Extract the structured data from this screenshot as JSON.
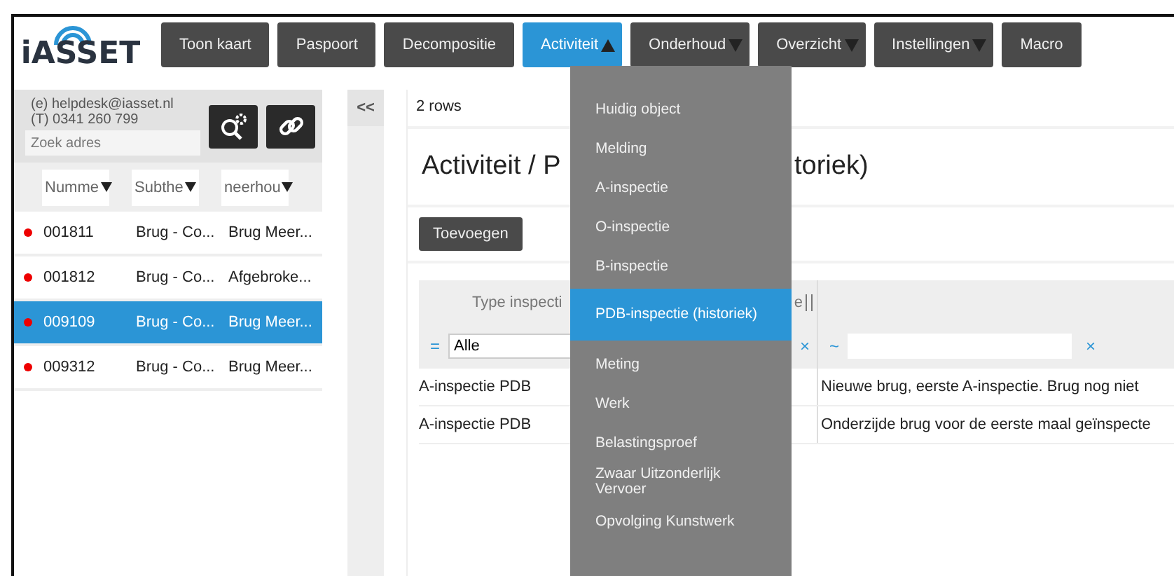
{
  "logo": {
    "text": "iASSET"
  },
  "nav": [
    {
      "label": "Toon kaart",
      "selected": false,
      "dropdown": false
    },
    {
      "label": "Paspoort",
      "selected": false,
      "dropdown": false
    },
    {
      "label": "Decompositie",
      "selected": false,
      "dropdown": false
    },
    {
      "label": "Activiteit",
      "selected": true,
      "dropdown": true,
      "expanded": true
    },
    {
      "label": "Onderhoud",
      "selected": false,
      "dropdown": true,
      "expanded": false
    },
    {
      "label": "Overzicht",
      "selected": false,
      "dropdown": true,
      "expanded": false
    },
    {
      "label": "Instellingen",
      "selected": false,
      "dropdown": true,
      "expanded": false
    },
    {
      "label": "Macro",
      "selected": false,
      "dropdown": false
    }
  ],
  "sidebar": {
    "helpdesk": [
      "(e) helpdesk@iasset.nl",
      "(T) 0341 260 799"
    ],
    "search": {
      "placeholder": "Zoek adres"
    },
    "columns": [
      "Numme",
      "Subthe",
      "neerhou"
    ],
    "rows": [
      {
        "cells": [
          "001811",
          "Brug - Co...",
          "Brug Meer..."
        ],
        "selected": false
      },
      {
        "cells": [
          "001812",
          "Brug - Co...",
          "Afgebroke..."
        ],
        "selected": false
      },
      {
        "cells": [
          "009109",
          "Brug - Co...",
          "Brug Meer..."
        ],
        "selected": true
      },
      {
        "cells": [
          "009312",
          "Brug - Co...",
          "Brug Meer..."
        ],
        "selected": false
      }
    ],
    "collapse": "<<"
  },
  "main": {
    "row_count": "2 rows",
    "title_parts": [
      "Activiteit / P",
      "toriek)"
    ],
    "add_button": "Toevoegen",
    "table": {
      "columns": [
        "Type inspecti",
        "e"
      ],
      "filter": {
        "operator_1": "=",
        "value_1": "Alle",
        "clear_1": "×",
        "operator_2": "~",
        "clear_2": "×"
      },
      "rows": [
        [
          "A-inspectie PDB",
          "Nieuwe brug, eerste A-inspectie. Brug nog niet"
        ],
        [
          "A-inspectie PDB",
          "Onderzijde brug voor de eerste maal geïnspecte"
        ]
      ]
    }
  },
  "menu": {
    "items": [
      {
        "label": "Huidig object",
        "selected": false
      },
      {
        "label": "Melding",
        "selected": false
      },
      {
        "label": "A-inspectie",
        "selected": false
      },
      {
        "label": "O-inspectie",
        "selected": false
      },
      {
        "label": "B-inspectie",
        "selected": false
      },
      {
        "label": "PDB-inspectie (historiek)",
        "selected": true
      },
      {
        "label": "Meting",
        "selected": false
      },
      {
        "label": "Werk",
        "selected": false
      },
      {
        "label": "Belastingsproef",
        "selected": false
      },
      {
        "label": "Zwaar Uitzonderlijk Vervoer",
        "selected": false
      },
      {
        "label": "Opvolging Kunstwerk",
        "selected": false
      }
    ]
  }
}
